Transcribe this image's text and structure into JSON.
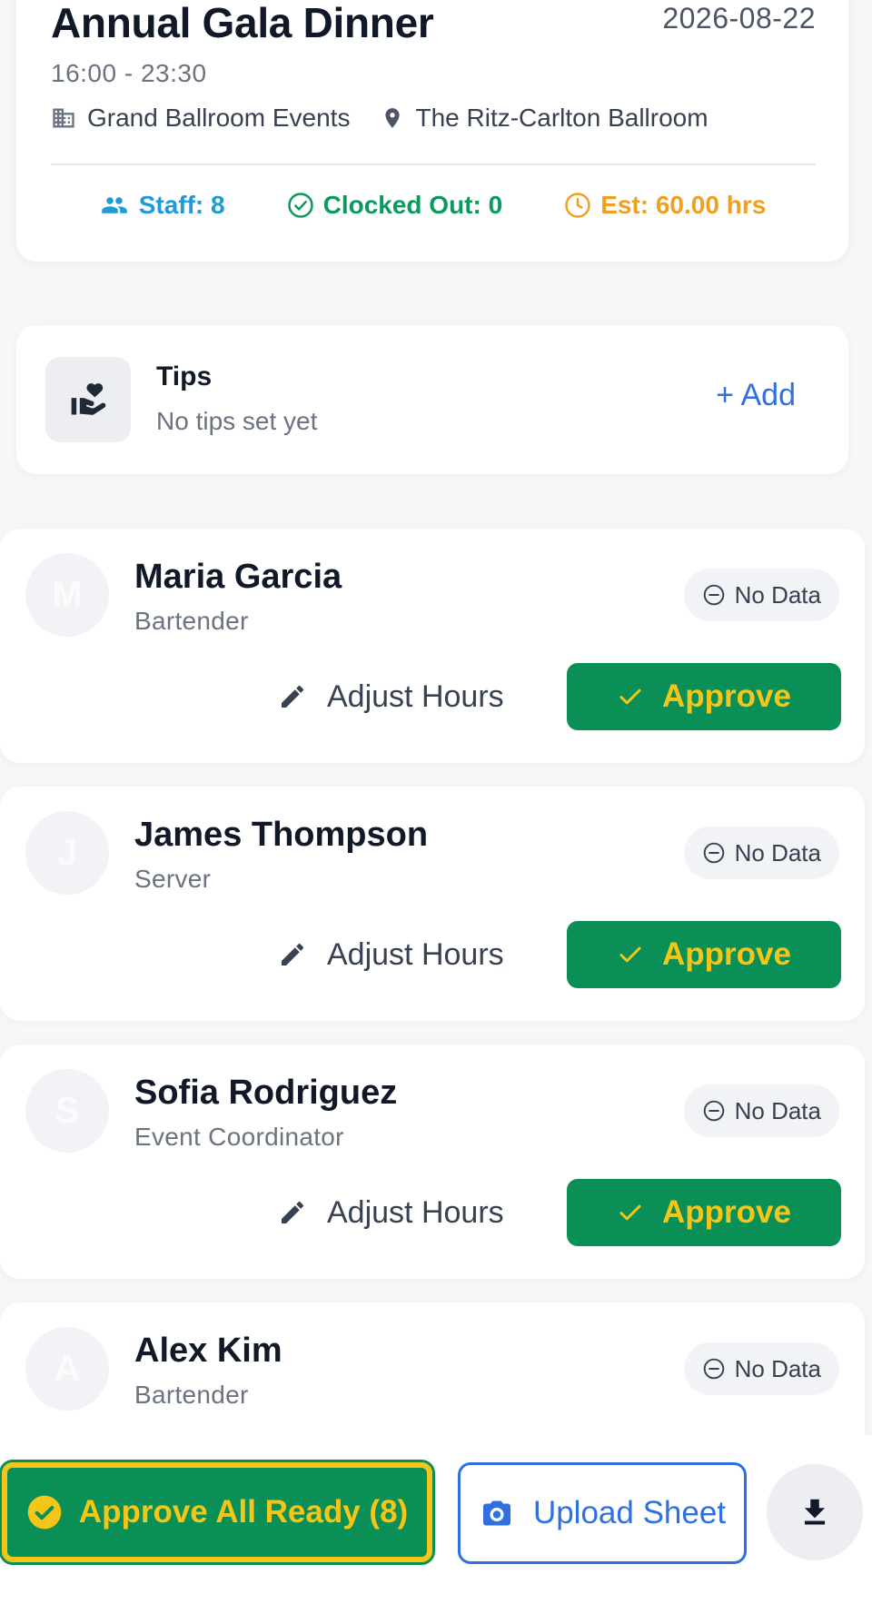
{
  "event": {
    "title": "Annual Gala Dinner",
    "date": "2026-08-22",
    "time": "16:00 - 23:30",
    "company": "Grand Ballroom Events",
    "venue": "The Ritz-Carlton Ballroom",
    "stats": {
      "staff": "Staff: 8",
      "clocked_out": "Clocked Out: 0",
      "estimate": "Est: 60.00 hrs"
    }
  },
  "tips": {
    "title": "Tips",
    "subtitle": "No tips set yet",
    "add_label": "+ Add"
  },
  "staff": [
    {
      "initial": "M",
      "name": "Maria Garcia",
      "role": "Bartender",
      "status": "No Data",
      "adjust_label": "Adjust Hours",
      "approve_label": "Approve"
    },
    {
      "initial": "J",
      "name": "James Thompson",
      "role": "Server",
      "status": "No Data",
      "adjust_label": "Adjust Hours",
      "approve_label": "Approve"
    },
    {
      "initial": "S",
      "name": "Sofia Rodriguez",
      "role": "Event Coordinator",
      "status": "No Data",
      "adjust_label": "Adjust Hours",
      "approve_label": "Approve"
    },
    {
      "initial": "A",
      "name": "Alex Kim",
      "role": "Bartender",
      "status": "No Data"
    }
  ],
  "actions": {
    "approve_all": "Approve All Ready (8)",
    "upload": "Upload Sheet"
  },
  "icons": {
    "company": "building-icon",
    "venue": "location-pin-icon",
    "staff": "people-icon",
    "clocked": "check-circle-icon",
    "estimate": "clock-icon",
    "tips": "hand-heart-icon",
    "status": "minus-circle-icon",
    "adjust": "pencil-icon",
    "approve": "check-icon",
    "upload": "camera-icon",
    "download": "download-icon"
  },
  "colors": {
    "primary_green": "#0a8f57",
    "accent_yellow": "#f5c518",
    "link_blue": "#2f6fe0",
    "staff_blue": "#1e9bd7",
    "clocked_green": "#0b9a5c",
    "estimate_orange": "#f0a020"
  }
}
